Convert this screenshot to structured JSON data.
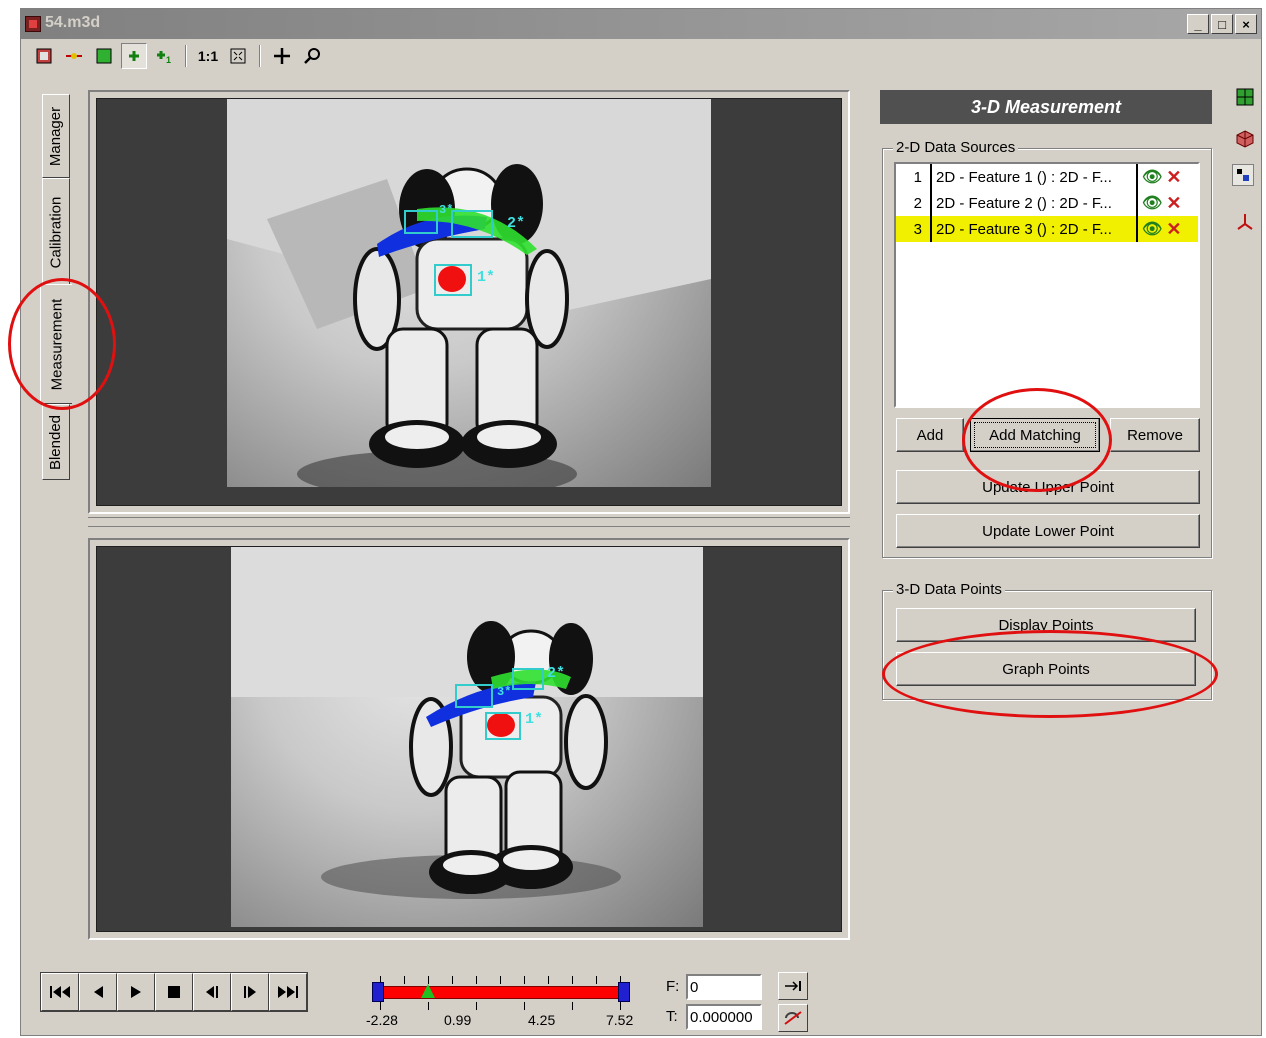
{
  "window": {
    "title": "54.m3d",
    "minimize": "_",
    "maximize": "□",
    "close": "×"
  },
  "toolbar": {
    "zoom_1to1": "1:1"
  },
  "tabs": [
    {
      "label": "Manager"
    },
    {
      "label": "Calibration"
    },
    {
      "label": "Measurement",
      "active": true
    },
    {
      "label": "Blended"
    }
  ],
  "views": {
    "top": {
      "labels": [
        "1*",
        "2*",
        "3*"
      ]
    },
    "bottom": {
      "labels": [
        "1*",
        "2*",
        "3*"
      ]
    }
  },
  "panel": {
    "title": "3-D Measurement",
    "sources_group": "2-D Data Sources",
    "sources": [
      {
        "num": "1",
        "name": "2D - Feature 1 () : 2D - F...",
        "selected": false
      },
      {
        "num": "2",
        "name": "2D - Feature 2 () : 2D - F...",
        "selected": false
      },
      {
        "num": "3",
        "name": "2D - Feature 3 () : 2D - F...",
        "selected": true
      }
    ],
    "add": "Add",
    "add_matching": "Add Matching",
    "remove": "Remove",
    "update_upper": "Update Upper Point",
    "update_lower": "Update Lower Point",
    "points_group": "3-D Data Points",
    "display_points": "Display Points",
    "graph_points": "Graph Points"
  },
  "playback": {
    "ticks": [
      "-2.28",
      "0.99",
      "4.25",
      "7.52"
    ],
    "frame_label": "F:",
    "frame_value": "0",
    "time_label": "T:",
    "time_value": "0.000000",
    "marker_fraction": 0.2
  },
  "colors": {
    "annotation": "#e01010",
    "selected_row": "#f0f000",
    "header": "#505050"
  }
}
